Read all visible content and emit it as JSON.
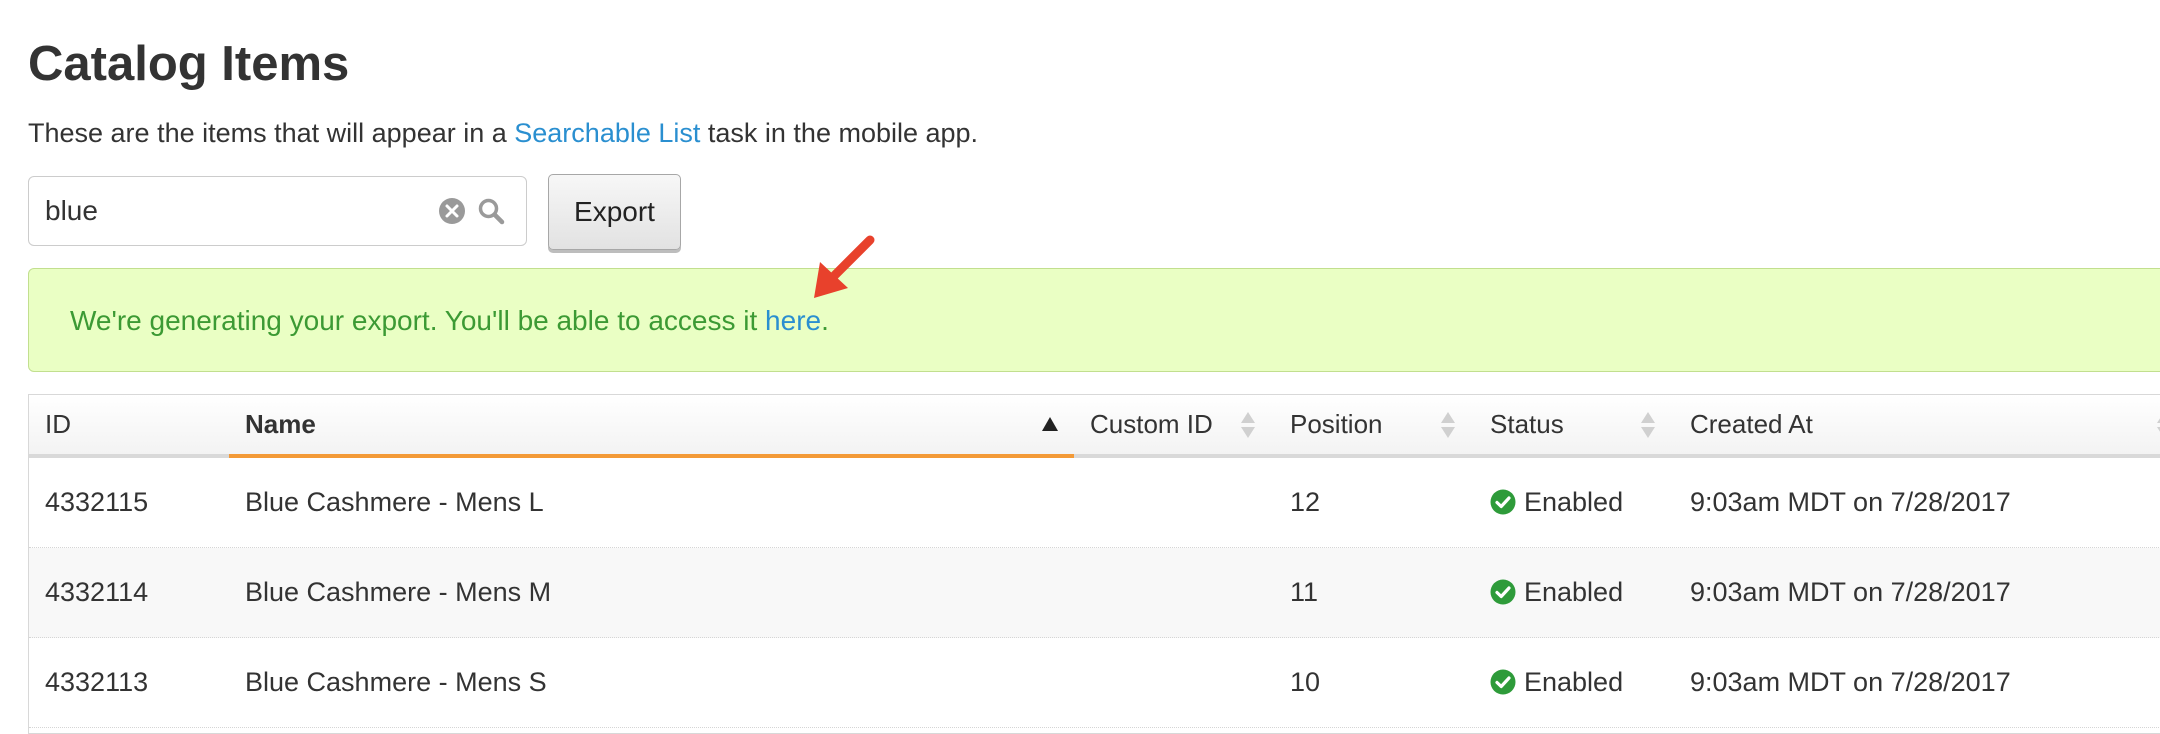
{
  "page": {
    "title": "Catalog Items",
    "intro_before": "These are the items that will appear in a ",
    "intro_link": "Searchable List",
    "intro_after": " task in the mobile app."
  },
  "search": {
    "value": "blue",
    "clear_icon": "clear-icon",
    "search_icon": "search-icon"
  },
  "toolbar": {
    "export_label": "Export"
  },
  "alert": {
    "text": "We're generating your export. You'll be able to access it ",
    "link": "here",
    "trailing": ".",
    "annotation_icon": "red-arrow-icon"
  },
  "table": {
    "columns": [
      {
        "label": "ID",
        "sortable": false
      },
      {
        "label": "Name",
        "sorted": "ascending"
      },
      {
        "label": "Custom ID",
        "sortable": true
      },
      {
        "label": "Position",
        "sortable": true
      },
      {
        "label": "Status",
        "sortable": true
      },
      {
        "label": "Created At",
        "sortable": true
      }
    ],
    "rows": [
      {
        "id": "4332115",
        "name": "Blue Cashmere - Mens L",
        "custom_id": "",
        "position": "12",
        "status": "Enabled",
        "created_at": "9:03am MDT on 7/28/2017"
      },
      {
        "id": "4332114",
        "name": "Blue Cashmere - Mens M",
        "custom_id": "",
        "position": "11",
        "status": "Enabled",
        "created_at": "9:03am MDT on 7/28/2017"
      },
      {
        "id": "4332113",
        "name": "Blue Cashmere - Mens S",
        "custom_id": "",
        "position": "10",
        "status": "Enabled",
        "created_at": "9:03am MDT on 7/28/2017"
      }
    ]
  },
  "colors": {
    "link": "#2a8fd0",
    "alert_bg": "#eaffc4",
    "alert_text": "#3c9a34",
    "sort_accent": "#f39a37",
    "status_enabled": "#2e9b3a",
    "annotation_arrow": "#e8412c"
  }
}
